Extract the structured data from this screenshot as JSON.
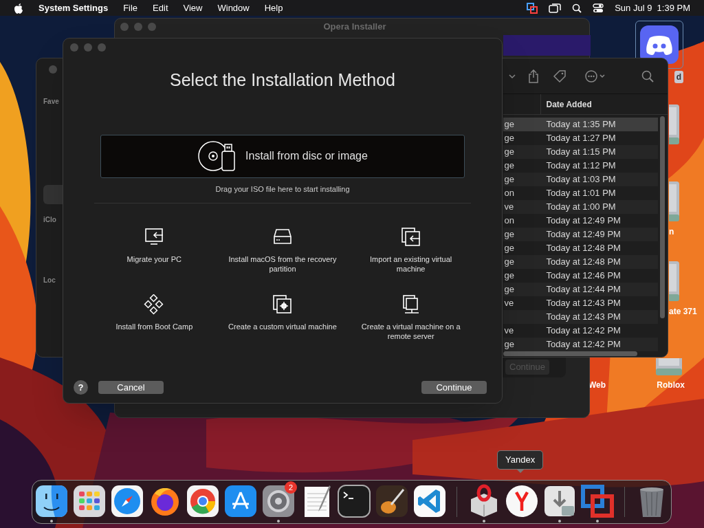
{
  "menu_bar": {
    "app_name": "System Settings",
    "menus": [
      "File",
      "Edit",
      "View",
      "Window",
      "Help"
    ],
    "clock": "Sun Jul 9  1:39 PM"
  },
  "background_window": {
    "title": "Opera Installer",
    "button": "Continue"
  },
  "finder_window": {
    "sidebar_labels": [
      "Fave",
      "iClo",
      "Loc"
    ],
    "column": "Date Added",
    "rows": [
      {
        "name": "ge",
        "date": "Today at 1:35 PM",
        "selected": true
      },
      {
        "name": "ge",
        "date": "Today at 1:27 PM",
        "selected": false
      },
      {
        "name": "ge",
        "date": "Today at 1:15 PM",
        "selected": false
      },
      {
        "name": "ge",
        "date": "Today at 1:12 PM",
        "selected": false
      },
      {
        "name": "ge",
        "date": "Today at 1:03 PM",
        "selected": false
      },
      {
        "name": "on",
        "date": "Today at 1:01 PM",
        "selected": false
      },
      {
        "name": "ve",
        "date": "Today at 1:00 PM",
        "selected": false
      },
      {
        "name": "on",
        "date": "Today at 12:49 PM",
        "selected": false
      },
      {
        "name": "ge",
        "date": "Today at 12:49 PM",
        "selected": false
      },
      {
        "name": "ge",
        "date": "Today at 12:48 PM",
        "selected": false
      },
      {
        "name": "ge",
        "date": "Today at 12:48 PM",
        "selected": false
      },
      {
        "name": "ge",
        "date": "Today at 12:46 PM",
        "selected": false
      },
      {
        "name": "ge",
        "date": "Today at 12:44 PM",
        "selected": false
      },
      {
        "name": "ve",
        "date": "Today at 12:43 PM",
        "selected": false
      },
      {
        "date": "Today at 12:43 PM",
        "selected": false
      },
      {
        "name": "ve",
        "date": "Today at 12:42 PM",
        "selected": false
      },
      {
        "name": "ge",
        "date": "Today at 12:42 PM",
        "selected": false
      }
    ]
  },
  "desktop_icons": [
    {
      "kind": "app",
      "label": "d"
    },
    {
      "kind": "drive"
    },
    {
      "kind": "drive",
      "label": "n"
    },
    {
      "kind": "drive",
      "label": "ate 371"
    },
    {
      "kind": "label",
      "label": "Web"
    },
    {
      "kind": "drive",
      "label": "Roblox"
    }
  ],
  "dialog": {
    "title": "Select the Installation Method",
    "primary_option": "Install from disc or image",
    "hint": "Drag your ISO file here to start installing",
    "options": [
      {
        "kind": "migrate",
        "label": "Migrate your PC"
      },
      {
        "kind": "recovery",
        "label": "Install macOS from the recovery partition"
      },
      {
        "kind": "import",
        "label": "Import an existing virtual machine"
      },
      {
        "kind": "bootcamp",
        "label": "Install from Boot Camp"
      },
      {
        "kind": "custom",
        "label": "Create a custom virtual machine"
      },
      {
        "kind": "remote",
        "label": "Create a virtual machine on a remote server"
      }
    ],
    "help": "?",
    "cancel": "Cancel",
    "continue": "Continue"
  },
  "dock": {
    "tooltip": "Yandex",
    "items": [
      {
        "kind": "finder",
        "running": true
      },
      {
        "kind": "launchpad",
        "running": false
      },
      {
        "kind": "safari",
        "running": false
      },
      {
        "kind": "firefox",
        "running": false
      },
      {
        "kind": "chrome",
        "running": false
      },
      {
        "kind": "appstore",
        "running": false
      },
      {
        "kind": "settings",
        "running": true,
        "badge": "2"
      },
      {
        "kind": "textedit",
        "running": false
      },
      {
        "kind": "terminal",
        "running": false
      },
      {
        "kind": "guitar",
        "running": false
      },
      {
        "kind": "vscode",
        "running": false
      },
      {
        "kind": "separator"
      },
      {
        "kind": "opera",
        "running": true
      },
      {
        "kind": "yandex",
        "running": false
      },
      {
        "kind": "installer",
        "running": true
      },
      {
        "kind": "parallels",
        "running": true
      },
      {
        "kind": "separator"
      },
      {
        "kind": "trash",
        "running": false
      }
    ]
  }
}
